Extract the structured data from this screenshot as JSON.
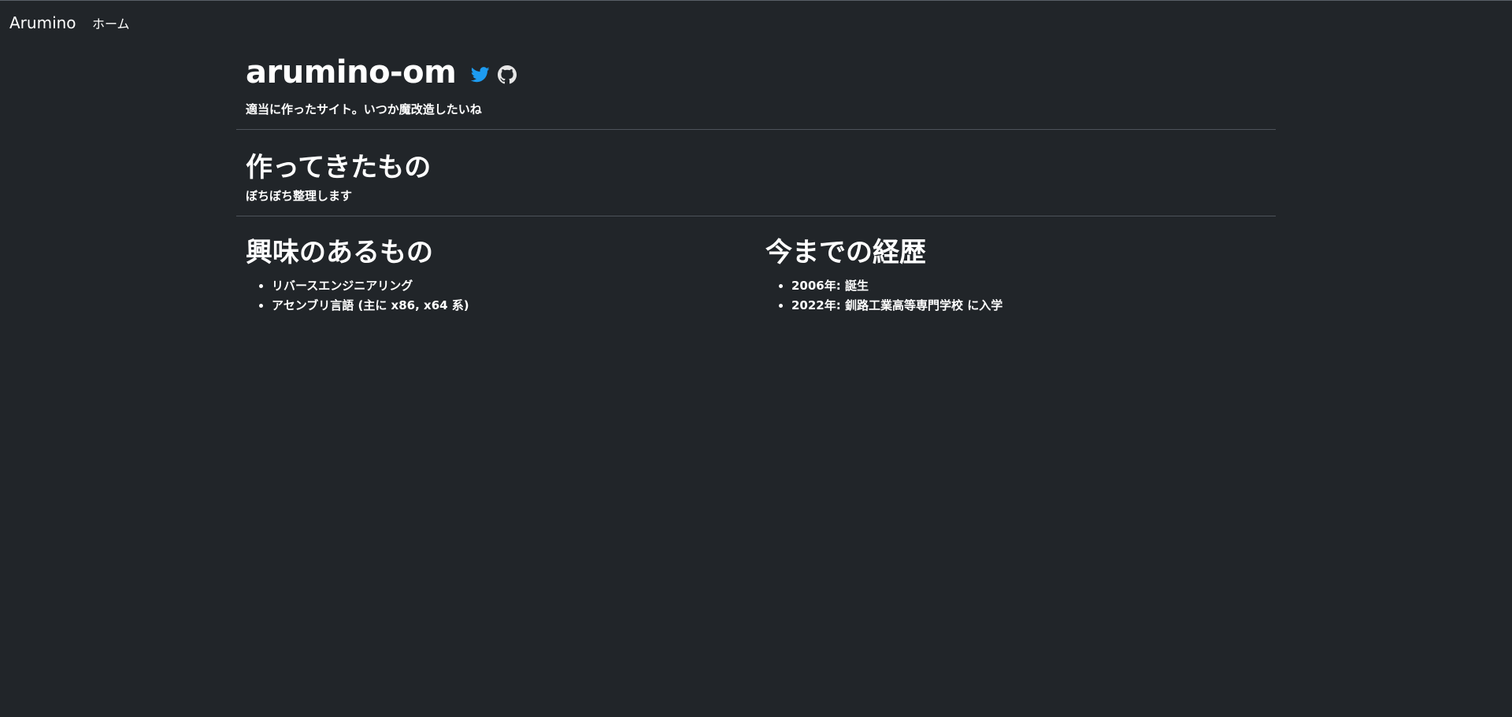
{
  "navbar": {
    "brand": "Arumino",
    "links": [
      {
        "label": "ホーム"
      }
    ]
  },
  "header": {
    "title": "arumino-om",
    "subtitle": "適当に作ったサイト。いつか魔改造したいね",
    "icons": [
      {
        "name": "twitter-icon",
        "color": "#1d9bf0"
      },
      {
        "name": "github-icon",
        "color": "#e6e6e6"
      }
    ]
  },
  "works": {
    "title": "作ってきたもの",
    "subtitle": "ぼちぼち整理します"
  },
  "interests": {
    "title": "興味のあるもの",
    "items": [
      "リバースエンジニアリング",
      "アセンブリ言語 (主に x86, x64 系)"
    ]
  },
  "history": {
    "title": "今までの経歴",
    "items": [
      "2006年: 誕生",
      "2022年: 釧路工業高等専門学校 に入学"
    ]
  },
  "colors": {
    "background": "#212529",
    "text": "#ffffff",
    "divider": "#4d535a"
  }
}
